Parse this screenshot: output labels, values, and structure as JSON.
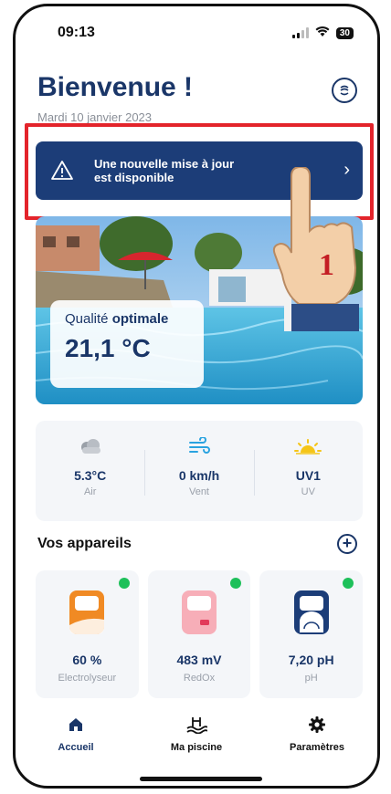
{
  "status_bar": {
    "time": "09:13",
    "battery": "30"
  },
  "header": {
    "title": "Bienvenue !",
    "date": "Mardi 10 janvier 2023",
    "icon": "pool-sensor-icon"
  },
  "update_banner": {
    "line1": "Une nouvelle mise à jour",
    "line2": "est disponible",
    "icon": "warning-icon",
    "annotation_number": "1"
  },
  "hero": {
    "quality_prefix": "Qualité ",
    "quality_value": "optimale",
    "temperature": "21,1 °C"
  },
  "weather": [
    {
      "value": "5.3°C",
      "label": "Air",
      "icon": "cloud-icon"
    },
    {
      "value": "0 km/h",
      "label": "Vent",
      "icon": "wind-icon"
    },
    {
      "value": "UV1",
      "label": "UV",
      "icon": "sun-icon"
    }
  ],
  "devices": {
    "title": "Vos appareils",
    "items": [
      {
        "value": "60 %",
        "label": "Electrolyseur",
        "color": "#f08a24"
      },
      {
        "value": "483 mV",
        "label": "RedOx",
        "color": "#f7aeb8"
      },
      {
        "value": "7,20 pH",
        "label": "pH",
        "color": "#1c3d78"
      }
    ]
  },
  "tabs": [
    {
      "label": "Accueil",
      "icon": "home-icon",
      "active": true
    },
    {
      "label": "Ma piscine",
      "icon": "pool-icon"
    },
    {
      "label": "Paramètres",
      "icon": "gear-icon"
    }
  ],
  "colors": {
    "navy": "#1a3668",
    "banner": "#1c3d78",
    "highlight": "#e3242b",
    "status_ok": "#1ec05a"
  }
}
